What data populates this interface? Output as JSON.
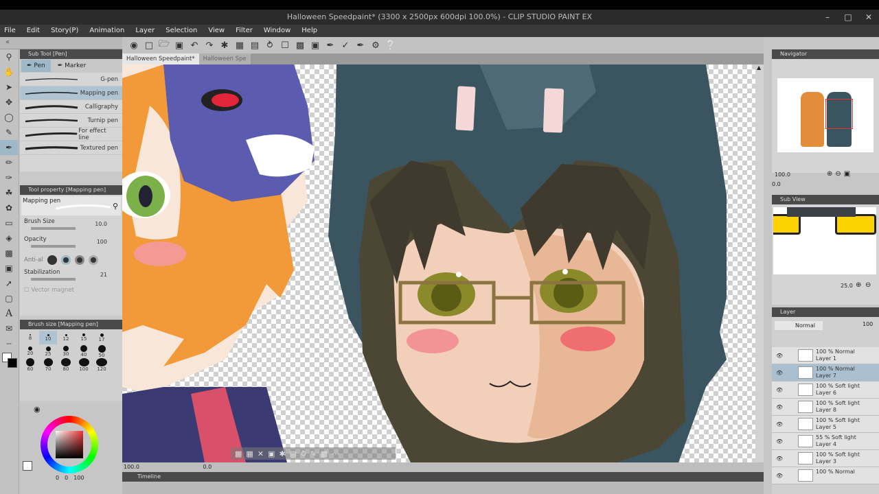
{
  "window": {
    "title": "Halloween Speedpaint* (3300 x 2500px 600dpi 100.0%) - CLIP STUDIO PAINT EX",
    "controls": [
      "–",
      "□",
      "✕"
    ]
  },
  "menu": [
    "File",
    "Edit",
    "Story(P)",
    "Animation",
    "Layer",
    "Selection",
    "View",
    "Filter",
    "Window",
    "Help"
  ],
  "sub_tool": {
    "header": "Sub Tool [Pen]",
    "tabs": [
      "Pen",
      "Marker"
    ],
    "brushes": [
      "G-pen",
      "Mapping pen",
      "Calligraphy",
      "Turnip pen",
      "For effect line",
      "Textured pen"
    ]
  },
  "tool_property": {
    "header": "Tool property [Mapping pen]",
    "current": "Mapping pen",
    "brush_size_label": "Brush Size",
    "brush_size_value": "10.0",
    "opacity_label": "Opacity",
    "opacity_value": "100",
    "antialias_label": "Anti-al",
    "stabilization_label": "Stabilization",
    "stabilization_value": "21",
    "vector_label": "Vector magnet"
  },
  "brush_size": {
    "header": "Brush size [Mapping pen]",
    "sizes": [
      "8",
      "10",
      "12",
      "15",
      "17",
      "20",
      "25",
      "30",
      "40",
      "50",
      "60",
      "70",
      "80",
      "100",
      "120"
    ]
  },
  "color": {
    "main": "#ffffff",
    "sub": "#000000",
    "values": [
      "0",
      "0",
      "100"
    ]
  },
  "canvas": {
    "doc_tabs": [
      "Halloween Speedpaint*",
      "Halloween Spe"
    ],
    "zoom": "100.0",
    "angle": "0.0",
    "timeline_label": "Timeline"
  },
  "navigator": {
    "header": "Navigator",
    "zoom": "100.0",
    "angle": "0.0"
  },
  "sub_view": {
    "header": "Sub View",
    "zoom": "25.0"
  },
  "layer": {
    "header": "Layer",
    "blend": "Normal",
    "opacity": "100",
    "rows": [
      {
        "mode": "100 % Normal",
        "name": "Layer 1"
      },
      {
        "mode": "100 % Normal",
        "name": "Layer 7"
      },
      {
        "mode": "100 % Soft light",
        "name": "Layer 6"
      },
      {
        "mode": "100 % Soft light",
        "name": "Layer 8"
      },
      {
        "mode": "100 % Soft light",
        "name": "Layer 5"
      },
      {
        "mode": "55 % Soft light",
        "name": "Layer 4"
      },
      {
        "mode": "100 % Soft light",
        "name": "Layer 3"
      },
      {
        "mode": "100 % Normal",
        "name": ""
      }
    ]
  }
}
